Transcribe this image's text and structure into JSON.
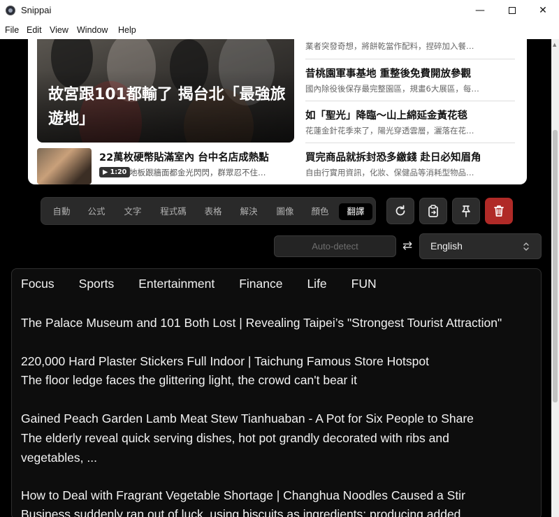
{
  "window": {
    "title": "Snippai",
    "minimize": "—",
    "close": "✕"
  },
  "menu": [
    "File",
    "Edit",
    "View",
    "Window",
    "Help"
  ],
  "snippet": {
    "hero_title": "故宮跟101都輸了 揭台北「最強旅遊地」",
    "video": {
      "title": "22萬枚硬幣貼滿室內 台中名店成熱點",
      "badge": "▶ 1:20",
      "subtitle": "地板跟牆面都金光閃閃，群眾忍不住…"
    },
    "news": [
      {
        "title": "",
        "subtitle": "業者突發奇想，將餅乾當作配料，捏碎加入餐…"
      },
      {
        "title": "昔桃園軍事基地 重整後免費開放參觀",
        "subtitle": "國內除役後保存最完整園區，規畫6大展區，每…"
      },
      {
        "title": "如「聖光」降臨～山上綿延金黃花毯",
        "subtitle": "花蓮金針花季來了，陽光穿透雲層，灑落在花…"
      },
      {
        "title": "買完商品就拆封恐多繳錢 赴日必知眉角",
        "subtitle": "自由行實用資訊，化妝、保健品等消耗型物品…"
      }
    ]
  },
  "modes": [
    "自動",
    "公式",
    "文字",
    "程式碼",
    "表格",
    "解決",
    "圖像",
    "顏色",
    "翻譯"
  ],
  "active_mode": "翻譯",
  "tools": [
    "refresh-icon",
    "copy-clipboard-icon",
    "pin-icon",
    "trash-icon"
  ],
  "translate": {
    "source": "Auto-detect",
    "swap": "⇄",
    "target": "English"
  },
  "output": {
    "nav": [
      "Focus",
      "Sports",
      "Entertainment",
      "Finance",
      "Life",
      "FUN"
    ],
    "lines": [
      "The Palace Museum and 101 Both Lost | Revealing Taipei’s \"Strongest Tourist Attraction\"",
      "220,000 Hard Plaster Stickers Full Indoor | Taichung Famous Store Hotspot",
      "The floor ledge faces the glittering light, the crowd can't bear it",
      "Gained Peach Garden Lamb Meat Stew Tianhuaban - A Pot for Six People to Share",
      "The elderly reveal quick serving dishes, hot pot grandly decorated with ribs and",
      "vegetables, ...",
      "How to Deal with Fragrant Vegetable Shortage | Changhua Noodles Caused a Stir",
      "Business suddenly ran out of luck, using biscuits as ingredients; producing added"
    ]
  },
  "colors": {
    "accent_danger": "#b02a27",
    "panel": "#0d0d0d",
    "toolbar": "#2a2a2a"
  }
}
